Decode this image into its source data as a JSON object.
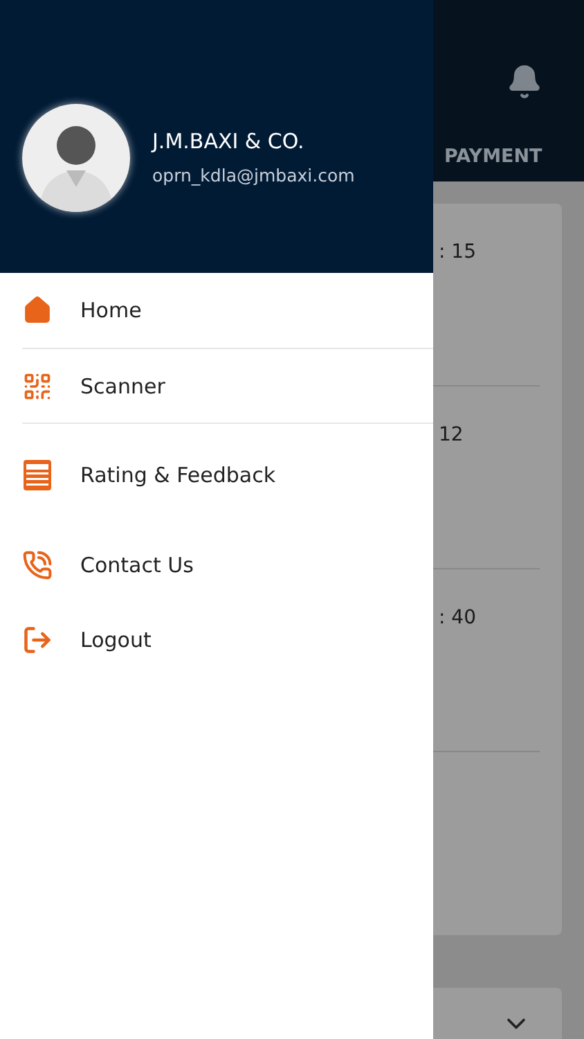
{
  "drawer": {
    "profile": {
      "name": "J.M.BAXI & CO.",
      "email": "oprn_kdla@jmbaxi.com"
    },
    "items": [
      {
        "label": "Home",
        "kind": "home",
        "divider": true
      },
      {
        "label": "Scanner",
        "kind": "qr",
        "divider": true
      },
      {
        "label": "Rating & Feedback",
        "kind": "form",
        "divider": false
      },
      {
        "label": "Contact Us",
        "kind": "phone",
        "divider": false
      },
      {
        "label": "Logout",
        "kind": "logout",
        "divider": false
      }
    ]
  },
  "background": {
    "tab": "PAYMENT",
    "card_lines": [
      ": 15",
      "12",
      ": 40"
    ]
  }
}
